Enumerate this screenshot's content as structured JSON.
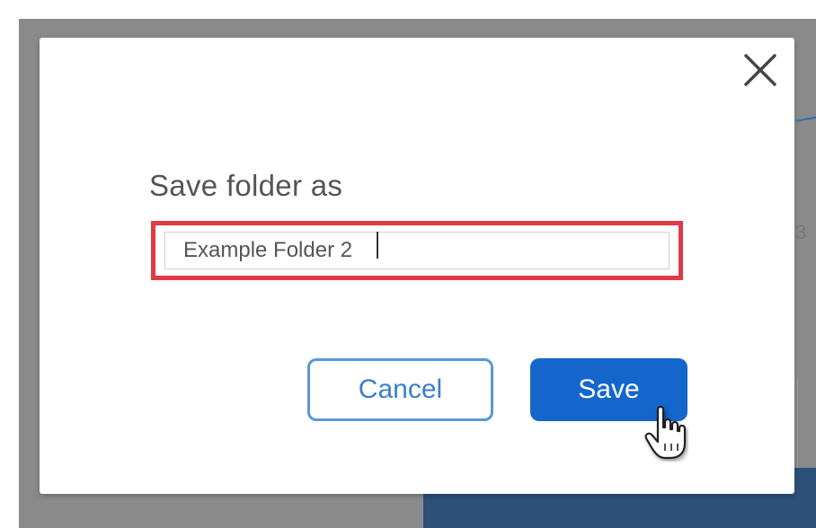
{
  "dialog": {
    "title": "Save folder as",
    "input_value": "Example Folder 2",
    "cancel_label": "Cancel",
    "save_label": "Save"
  },
  "background": {
    "partial_glyph": "3"
  },
  "colors": {
    "accent": "#1466cc",
    "highlight_border": "#e23a44",
    "cancel_text": "#3a7fcb"
  },
  "icons": {
    "close": "close-icon",
    "pointer": "hand-pointer-cursor-icon"
  }
}
